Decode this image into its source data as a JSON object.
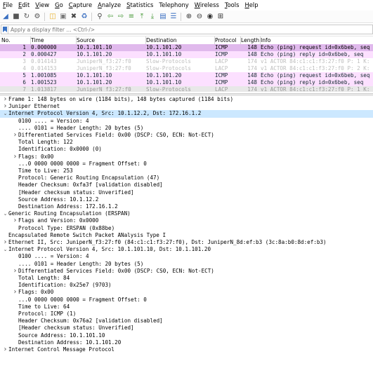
{
  "menu": [
    "File",
    "Edit",
    "View",
    "Go",
    "Capture",
    "Analyze",
    "Statistics",
    "Telephony",
    "Wireless",
    "Tools",
    "Help"
  ],
  "menu_mnemonic": [
    "F",
    "E",
    "V",
    "G",
    "C",
    "A",
    "S",
    "",
    "W",
    "T",
    "H"
  ],
  "toolbar_icons": [
    "shark-fin-start-icon",
    "stop-square-icon",
    "restart-icon",
    "capture-options-gear-icon",
    "open-folder-icon",
    "open-file-icon",
    "close-file-icon",
    "reload-icon",
    "find-magnifier-icon",
    "go-back-arrow-icon",
    "go-forward-arrow-icon",
    "go-to-packet-icon",
    "go-first-icon",
    "go-last-icon",
    "autoscroll-icon",
    "colorize-icon",
    "zoom-in-icon",
    "zoom-out-icon",
    "normal-size-icon",
    "resize-columns-icon"
  ],
  "filter": {
    "placeholder": "Apply a display filter ... <Ctrl-/>"
  },
  "columns": {
    "no": "No.",
    "time": "Time",
    "source": "Source",
    "destination": "Destination",
    "protocol": "Protocol",
    "length": "Length",
    "info": "Info"
  },
  "packets": [
    {
      "no": "1",
      "time": "0.000000",
      "source": "10.1.101.10",
      "destination": "10.1.101.20",
      "protocol": "ICMP",
      "length": "148",
      "info": "Echo (ping) request  id=0x6beb, seq",
      "style": "sel"
    },
    {
      "no": "2",
      "time": "0.000427",
      "source": "10.1.101.20",
      "destination": "10.1.101.10",
      "protocol": "ICMP",
      "length": "148",
      "info": "Echo (ping) reply    id=0x6beb, seq",
      "style": "icmp"
    },
    {
      "no": "3",
      "time": "0.014143",
      "source": "JuniperN_f3:27:f0",
      "destination": "Slow-Protocols",
      "protocol": "LACP",
      "length": "174",
      "info": "v1 ACTOR 84:c1:c1:f3:27:f0 P: 1 K:",
      "style": "lacp"
    },
    {
      "no": "4",
      "time": "0.014153",
      "source": "JuniperN_f3:27:f0",
      "destination": "Slow-Protocols",
      "protocol": "LACP",
      "length": "174",
      "info": "v1 ACTOR 84:c1:c1:f3:27:f0 P: 2 K:",
      "style": "lacp"
    },
    {
      "no": "5",
      "time": "1.001085",
      "source": "10.1.101.10",
      "destination": "10.1.101.20",
      "protocol": "ICMP",
      "length": "148",
      "info": "Echo (ping) request  id=0x6beb, seq",
      "style": "icmp"
    },
    {
      "no": "6",
      "time": "1.001523",
      "source": "10.1.101.20",
      "destination": "10.1.101.10",
      "protocol": "ICMP",
      "length": "148",
      "info": "Echo (ping) reply    id=0x6beb, seq",
      "style": "icmp"
    },
    {
      "no": "7",
      "time": "1.013817",
      "source": "JuniperN_f3:27:f0",
      "destination": "Slow-Protocols",
      "protocol": "LACP",
      "length": "174",
      "info": "v1 ACTOR 84:c1:c1:f3:27:f0 P: 1 K:",
      "style": "partial"
    }
  ],
  "details": [
    {
      "indent": 0,
      "arrow": "collapsed",
      "text": "Frame 1: 148 bytes on wire (1184 bits), 148 bytes captured (1184 bits)"
    },
    {
      "indent": 0,
      "arrow": "collapsed",
      "text": "Juniper Ethernet"
    },
    {
      "indent": 0,
      "arrow": "expanded",
      "text": "Internet Protocol Version 4, Src: 10.1.12.2, Dst: 172.16.1.2",
      "hl": true
    },
    {
      "indent": 1,
      "arrow": "none",
      "text": "0100 .... = Version: 4"
    },
    {
      "indent": 1,
      "arrow": "none",
      "text": ".... 0101 = Header Length: 20 bytes (5)"
    },
    {
      "indent": 1,
      "arrow": "collapsed",
      "text": "Differentiated Services Field: 0x00 (DSCP: CS0, ECN: Not-ECT)"
    },
    {
      "indent": 1,
      "arrow": "none",
      "text": "Total Length: 122"
    },
    {
      "indent": 1,
      "arrow": "none",
      "text": "Identification: 0x0000 (0)"
    },
    {
      "indent": 1,
      "arrow": "collapsed",
      "text": "Flags: 0x00"
    },
    {
      "indent": 1,
      "arrow": "none",
      "text": "...0 0000 0000 0000 = Fragment Offset: 0"
    },
    {
      "indent": 1,
      "arrow": "none",
      "text": "Time to Live: 253"
    },
    {
      "indent": 1,
      "arrow": "none",
      "text": "Protocol: Generic Routing Encapsulation (47)"
    },
    {
      "indent": 1,
      "arrow": "none",
      "text": "Header Checksum: 0xfa3f [validation disabled]"
    },
    {
      "indent": 1,
      "arrow": "none",
      "text": "[Header checksum status: Unverified]"
    },
    {
      "indent": 1,
      "arrow": "none",
      "text": "Source Address: 10.1.12.2"
    },
    {
      "indent": 1,
      "arrow": "none",
      "text": "Destination Address: 172.16.1.2"
    },
    {
      "indent": 0,
      "arrow": "expanded",
      "text": "Generic Routing Encapsulation (ERSPAN)"
    },
    {
      "indent": 1,
      "arrow": "collapsed",
      "text": "Flags and Version: 0x0000"
    },
    {
      "indent": 1,
      "arrow": "none",
      "text": "Protocol Type: ERSPAN (0x88be)"
    },
    {
      "indent": 0,
      "arrow": "none",
      "text": "Encapsulated Remote Switch Packet ANalysis Type I"
    },
    {
      "indent": 0,
      "arrow": "collapsed",
      "text": "Ethernet II, Src: JuniperN_f3:27:f0 (84:c1:c1:f3:27:f0), Dst: JuniperN_8d:ef:b3 (3c:8a:b0:8d:ef:b3)"
    },
    {
      "indent": 0,
      "arrow": "expanded",
      "text": "Internet Protocol Version 4, Src: 10.1.101.10, Dst: 10.1.101.20"
    },
    {
      "indent": 1,
      "arrow": "none",
      "text": "0100 .... = Version: 4"
    },
    {
      "indent": 1,
      "arrow": "none",
      "text": ".... 0101 = Header Length: 20 bytes (5)"
    },
    {
      "indent": 1,
      "arrow": "collapsed",
      "text": "Differentiated Services Field: 0x00 (DSCP: CS0, ECN: Not-ECT)"
    },
    {
      "indent": 1,
      "arrow": "none",
      "text": "Total Length: 84"
    },
    {
      "indent": 1,
      "arrow": "none",
      "text": "Identification: 0x25e7 (9703)"
    },
    {
      "indent": 1,
      "arrow": "collapsed",
      "text": "Flags: 0x00"
    },
    {
      "indent": 1,
      "arrow": "none",
      "text": "...0 0000 0000 0000 = Fragment Offset: 0"
    },
    {
      "indent": 1,
      "arrow": "none",
      "text": "Time to Live: 64"
    },
    {
      "indent": 1,
      "arrow": "none",
      "text": "Protocol: ICMP (1)"
    },
    {
      "indent": 1,
      "arrow": "none",
      "text": "Header Checksum: 0x76a2 [validation disabled]"
    },
    {
      "indent": 1,
      "arrow": "none",
      "text": "[Header checksum status: Unverified]"
    },
    {
      "indent": 1,
      "arrow": "none",
      "text": "Source Address: 10.1.101.10"
    },
    {
      "indent": 1,
      "arrow": "none",
      "text": "Destination Address: 10.1.101.20"
    },
    {
      "indent": 0,
      "arrow": "collapsed",
      "text": "Internet Control Message Protocol"
    }
  ],
  "colors": {
    "icmp_row": "#fce0ff",
    "selected_row": "#e0b9ec",
    "lacp_text": "#bdbdbd",
    "detail_highlight": "#cce8ff"
  }
}
